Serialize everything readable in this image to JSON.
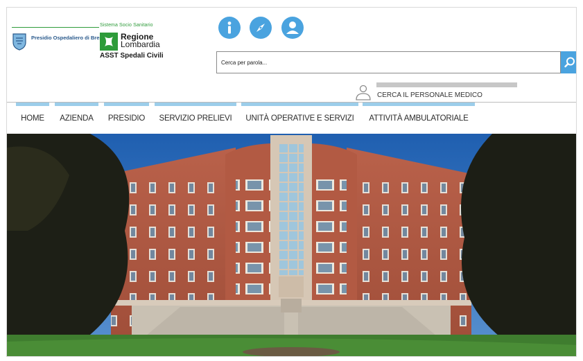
{
  "header": {
    "network_label": "Sistema Socio Sanitario",
    "presidio_logo_text": "Presidio Ospedaliero di Brescia",
    "region_name_line1": "Regione",
    "region_name_line2": "Lombardia",
    "organization": "ASST Spedali Civili",
    "icons": [
      "info-icon",
      "compass-icon",
      "user-icon"
    ]
  },
  "search": {
    "placeholder": "Cerca per parola..."
  },
  "staff_search": {
    "label": "CERCA IL PERSONALE MEDICO"
  },
  "nav": {
    "items": [
      {
        "label": "HOME"
      },
      {
        "label": "AZIENDA"
      },
      {
        "label": "PRESIDIO"
      },
      {
        "label": "SERVIZIO PRELIEVI"
      },
      {
        "label": "UNITÀ OPERATIVE E SERVIZI"
      },
      {
        "label": "ATTIVITÀ AMBULATORIALE"
      }
    ]
  },
  "colors": {
    "accent": "#4aa3df",
    "nav_accent": "#9ccdea",
    "region_green": "#2e9b3a"
  }
}
